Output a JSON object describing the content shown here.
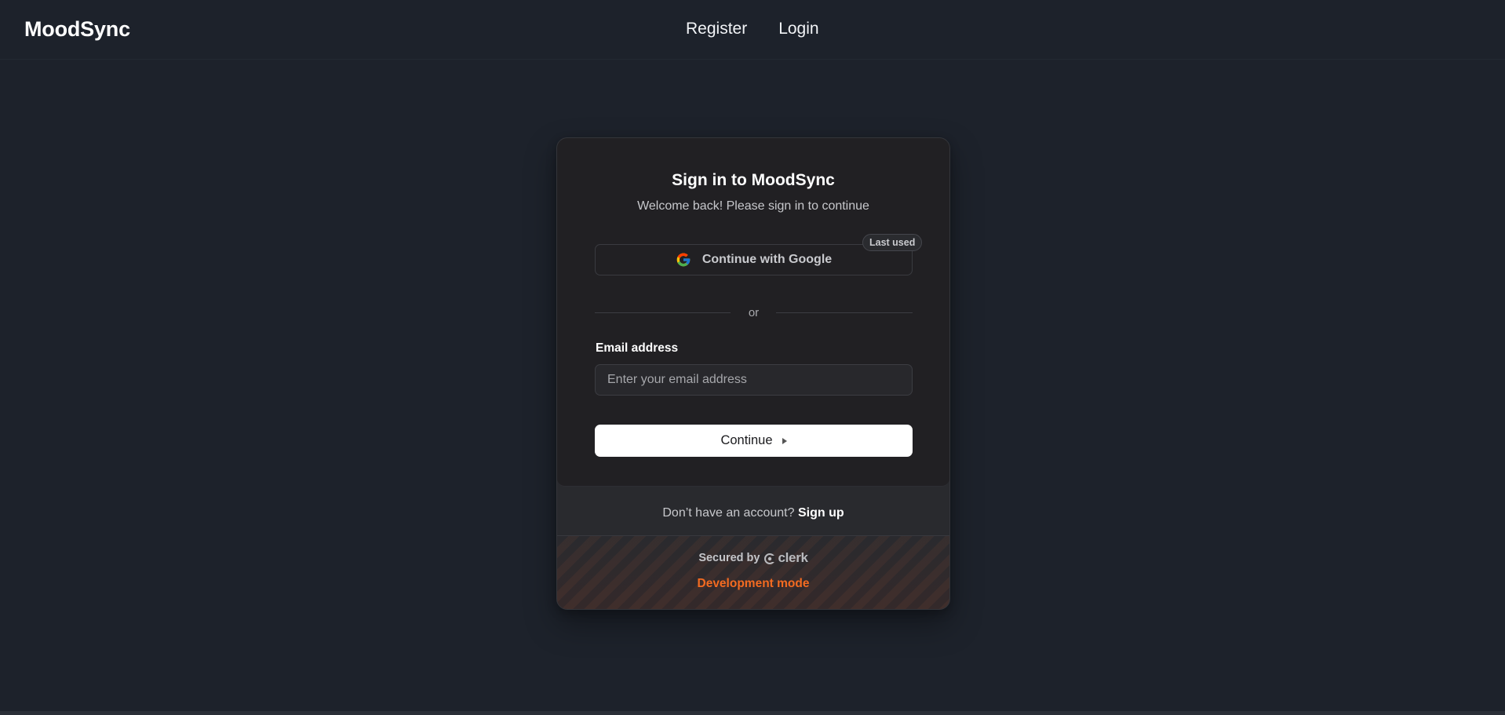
{
  "header": {
    "brand": "MoodSync",
    "nav": [
      {
        "label": "Register"
      },
      {
        "label": "Login"
      }
    ]
  },
  "signin": {
    "title": "Sign in to MoodSync",
    "subtitle": "Welcome back! Please sign in to continue",
    "google_button": "Continue with Google",
    "google_icon": "google-icon",
    "last_used_badge": "Last used",
    "divider_text": "or",
    "email_label": "Email address",
    "email_placeholder": "Enter your email address",
    "email_value": "",
    "continue_button": "Continue",
    "continue_icon": "play-arrow-icon",
    "no_account_text": "Don’t have an account?",
    "signup_link": "Sign up"
  },
  "footer": {
    "secured_by": "Secured by",
    "clerk_logo_text": "clerk",
    "dev_mode": "Development mode"
  },
  "colors": {
    "page_bg": "#1d222b",
    "card_bg": "#212023",
    "accent_dev": "#f36b21",
    "button_bg": "#ffffff"
  }
}
